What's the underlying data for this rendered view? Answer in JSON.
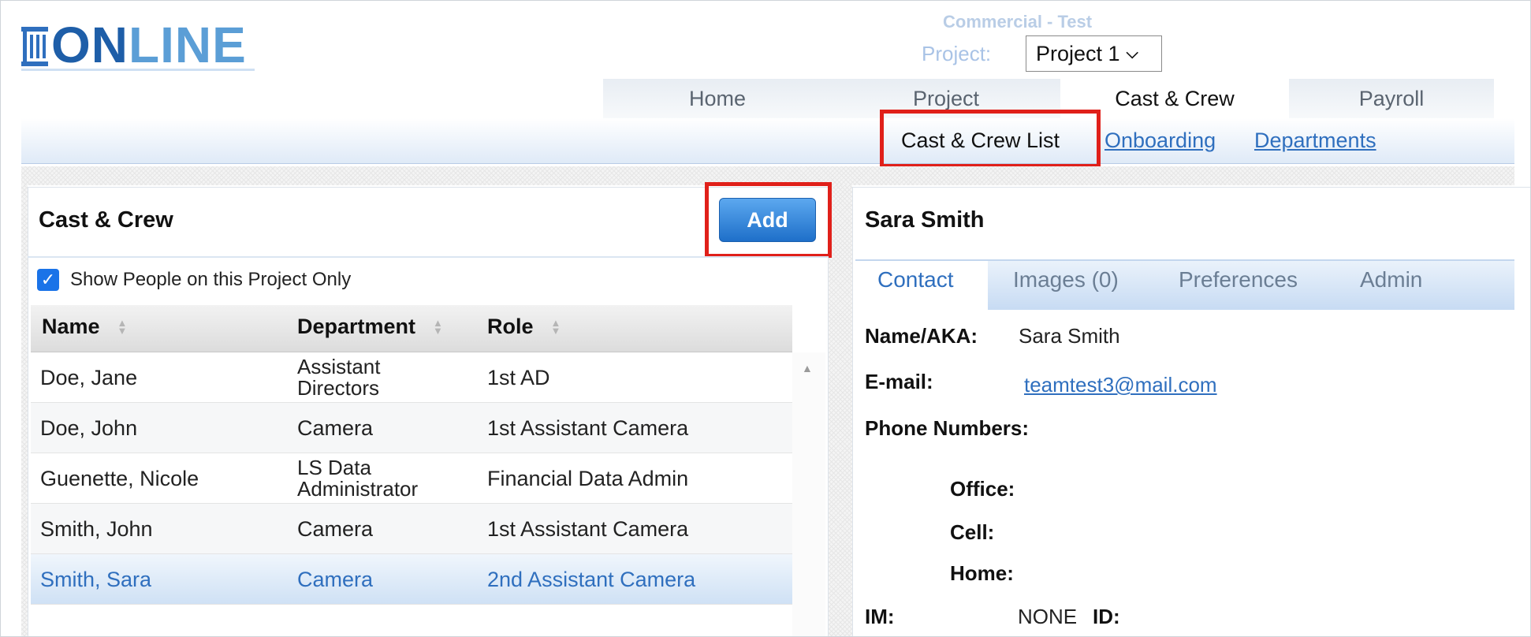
{
  "logo": {
    "text_on": "ON",
    "text_line": "LINE"
  },
  "header": {
    "company": "Commercial - Test",
    "project_label": "Project:",
    "project_value": "Project 1"
  },
  "main_tabs": [
    {
      "label": "Home",
      "active": false
    },
    {
      "label": "Project",
      "active": false
    },
    {
      "label": "Cast & Crew",
      "active": true
    },
    {
      "label": "Payroll",
      "active": false
    }
  ],
  "sub_nav": [
    {
      "label": "Cast & Crew List",
      "active": true
    },
    {
      "label": "Onboarding",
      "active": false
    },
    {
      "label": "Departments",
      "active": false
    }
  ],
  "left_panel": {
    "title": "Cast & Crew",
    "add_label": "Add",
    "show_only_label": "Show People on this Project Only",
    "show_only_checked": true,
    "columns": [
      "Name",
      "Department",
      "Role"
    ],
    "rows": [
      {
        "name": "Doe, Jane",
        "department": [
          "Assistant",
          "Directors"
        ],
        "role": "1st AD",
        "selected": false
      },
      {
        "name": "Doe, John",
        "department": [
          "Camera"
        ],
        "role": "1st Assistant Camera",
        "selected": false
      },
      {
        "name": "Guenette, Nicole",
        "department": [
          "LS Data",
          "Administrator"
        ],
        "role": "Financial Data Admin",
        "selected": false
      },
      {
        "name": "Smith, John",
        "department": [
          "Camera"
        ],
        "role": "1st Assistant Camera",
        "selected": false
      },
      {
        "name": "Smith, Sara",
        "department": [
          "Camera"
        ],
        "role": "2nd Assistant Camera",
        "selected": true
      }
    ]
  },
  "right_panel": {
    "title": "Sara Smith",
    "tabs": [
      {
        "label": "Contact",
        "active": true
      },
      {
        "label": "Images (0)",
        "active": false
      },
      {
        "label": "Preferences",
        "active": false
      },
      {
        "label": "Admin",
        "active": false
      }
    ],
    "name_label": "Name/AKA:",
    "name_value": "Sara Smith",
    "email_label": "E-mail:",
    "email_value": "teamtest3@mail.com",
    "phone_label": "Phone Numbers:",
    "office_label": "Office:",
    "cell_label": "Cell:",
    "home_label": "Home:",
    "im_label": "IM:",
    "im_value": "NONE",
    "id_label": "ID:"
  },
  "colors": {
    "brand_dark": "#1e5ea8",
    "brand_light": "#5b9ed6",
    "link": "#2f6fbe",
    "highlight_box": "#e0201a",
    "add_button": "#1e6fc9"
  }
}
